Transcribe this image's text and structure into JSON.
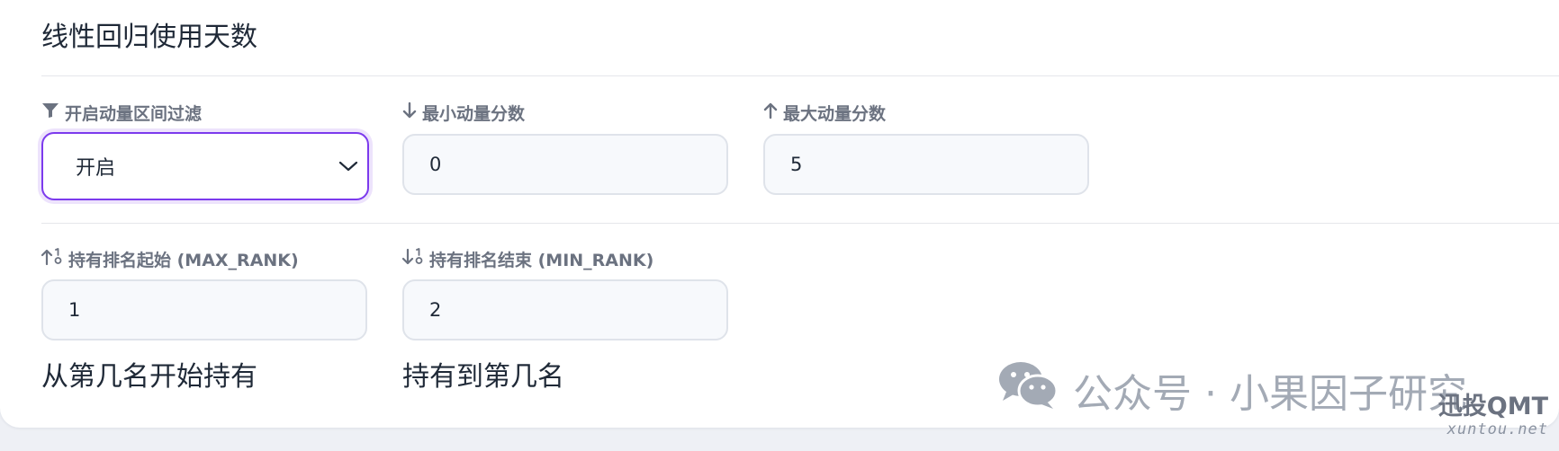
{
  "section_top": {
    "helper": "线性回归使用天数"
  },
  "momentum_filter": {
    "enable_label": "开启动量区间过滤",
    "enable_value": "开启",
    "min_label": "最小动量分数",
    "min_value": "0",
    "max_label": "最大动量分数",
    "max_value": "5"
  },
  "rank": {
    "start_label": "持有排名起始 (MAX_RANK)",
    "start_value": "1",
    "start_helper": "从第几名开始持有",
    "end_label": "持有排名结束 (MIN_RANK)",
    "end_value": "2",
    "end_helper": "持有到第几名"
  },
  "watermark": {
    "text": "公众号 · 小果因子研究"
  },
  "brand": {
    "title": "迅投QMT",
    "subtitle": "xuntou.net"
  },
  "colors": {
    "accent": "#7c3aed",
    "label": "#6b7280",
    "text": "#1f2937",
    "input_bg": "#f7f9fc"
  },
  "icons": {
    "enable": "filter-icon",
    "min": "arrow-down-icon",
    "max": "arrow-up-icon",
    "rank_start": "sort-numeric-up-icon",
    "rank_end": "sort-numeric-down-icon",
    "select": "chevron-down-icon",
    "watermark": "wechat-icon"
  }
}
